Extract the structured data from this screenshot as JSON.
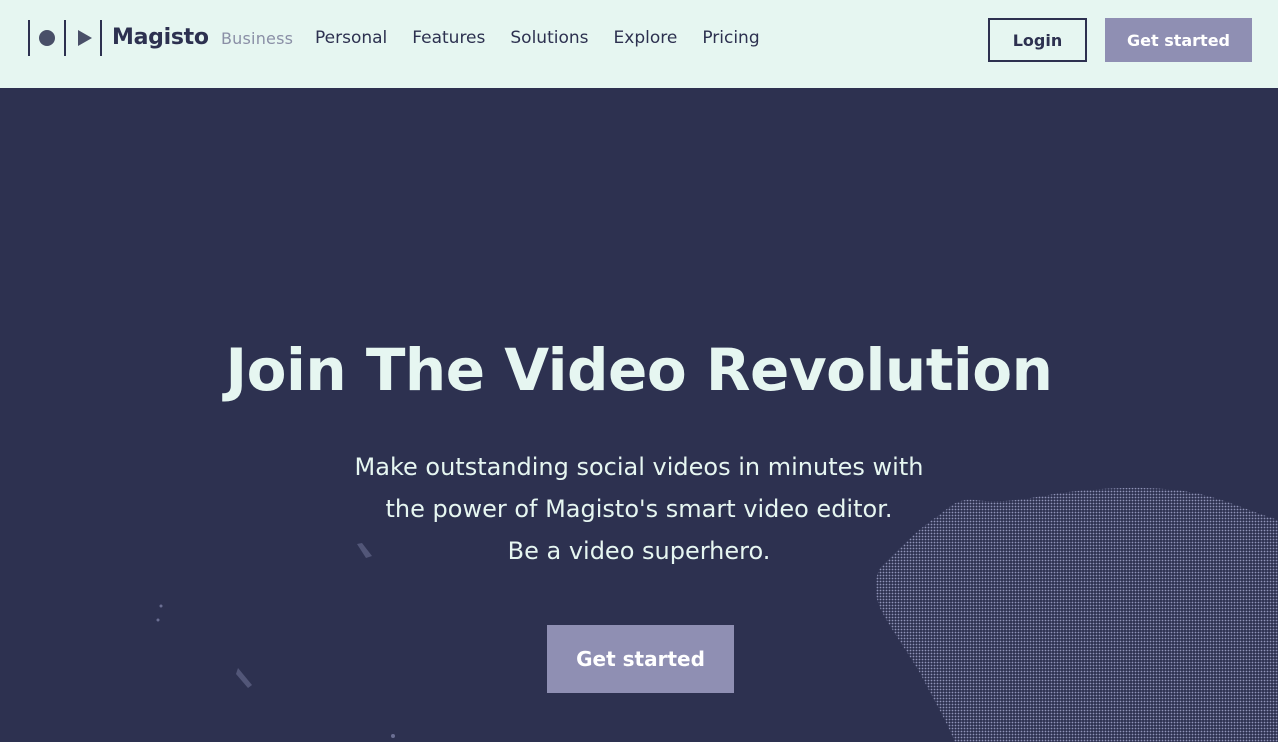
{
  "brand": {
    "name": "Magisto",
    "sub": "Business"
  },
  "nav": [
    {
      "label": "Personal"
    },
    {
      "label": "Features"
    },
    {
      "label": "Solutions"
    },
    {
      "label": "Explore"
    },
    {
      "label": "Pricing"
    }
  ],
  "header": {
    "login_label": "Login",
    "get_started_label": "Get started"
  },
  "hero": {
    "title": "Join The Video Revolution",
    "subtitle_lines": [
      "Make outstanding social videos in minutes with",
      "the power of Magisto's smart video editor.",
      "Be a video superhero."
    ],
    "cta_label": "Get started"
  },
  "colors": {
    "header_bg": "#e6f6f1",
    "hero_bg": "#2d3150",
    "text_dark": "#2d3150",
    "text_light": "#e6f6f1",
    "button_accent": "#8f8fb3",
    "muted": "#8a8fa6"
  },
  "icons": {
    "logo_left": "dot-icon",
    "logo_right": "play-icon"
  }
}
